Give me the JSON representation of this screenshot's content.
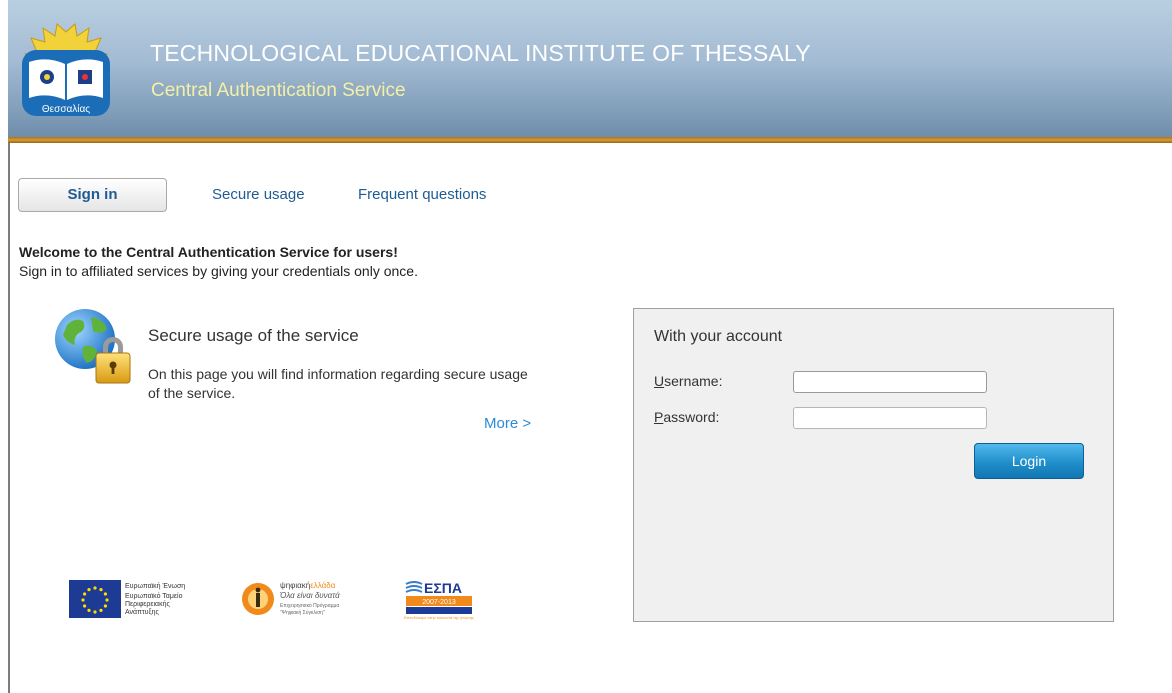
{
  "header": {
    "institute": "TECHNOLOGICAL EDUCATIONAL INSTITUTE OF THESSALY",
    "service": "Central Authentication Service",
    "logo_text": "Θεσσαλίας",
    "logo_icon": "tei-thessaly-logo"
  },
  "tabs": {
    "signin": "Sign in",
    "secure": "Secure usage",
    "faq": "Frequent questions"
  },
  "welcome": {
    "title": "Welcome to the Central Authentication Service for users!",
    "subtitle": "Sign in to affiliated services by giving your credentials only once."
  },
  "secure_block": {
    "icon": "globe-lock-icon",
    "title": "Secure usage of the service",
    "description": "On this page you will find information regarding secure usage of the service.",
    "more": "More >"
  },
  "login": {
    "heading": "With your account",
    "username_key": "U",
    "username_rest": "sername:",
    "password_key": "P",
    "password_rest": "assword:",
    "username_value": "",
    "password_value": "",
    "button": "Login"
  },
  "sponsors": {
    "eu": {
      "line1": "Ευρωπαϊκή Ένωση",
      "line2": "Ευρωπαϊκό Ταμείο",
      "line3": "Περιφερειακής",
      "line4": "Ανάπτυξης"
    },
    "digital": {
      "brand_a": "ψηφιακή",
      "brand_b": "ελλάδα",
      "slogan": "Όλα είναι δυνατά",
      "line1": "Επιχειρησιακό Πρόγραμμα",
      "line2": "\"Ψηφιακή Σύγκλιση\""
    },
    "espa": {
      "title": "ΕΣΠΑ",
      "years": "2007-2013",
      "tagline": "Επενδύουμε στην κοινωνία της γνώσης"
    }
  },
  "colors": {
    "link": "#1f5c93",
    "more_link": "#2a8cd7",
    "service_title": "#f4f0a6",
    "accent_rule": "#c58a2a",
    "login_button": "#1f8fcb"
  }
}
